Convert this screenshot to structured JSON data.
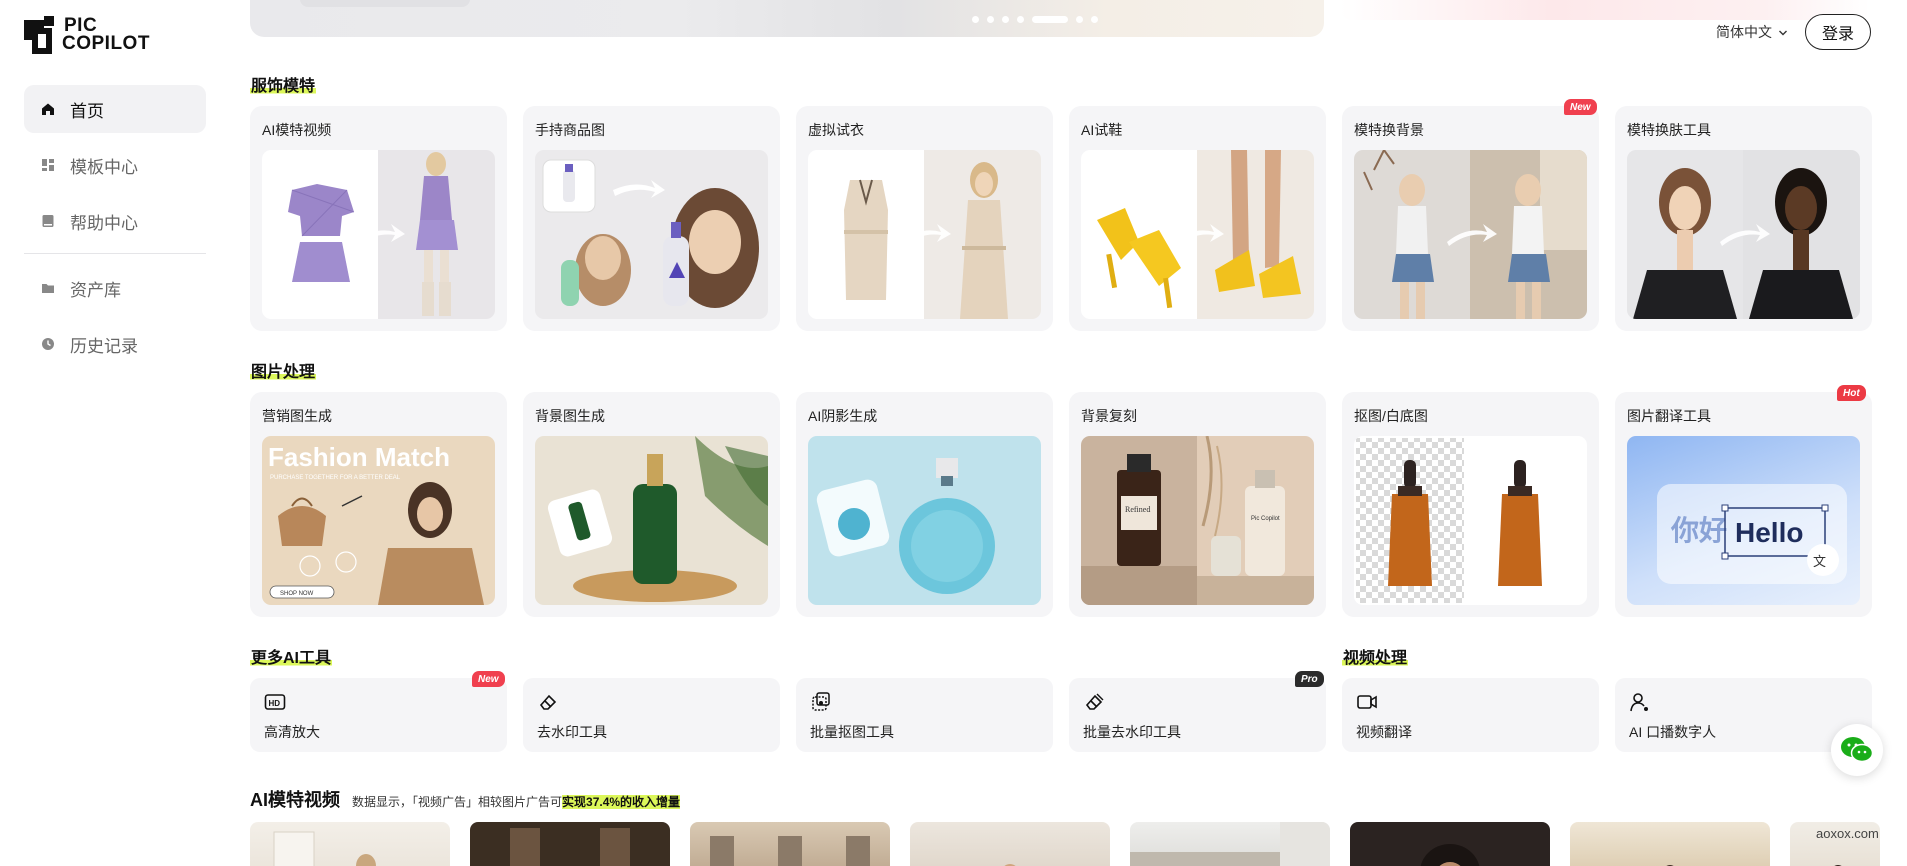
{
  "app": {
    "logo_line1": "PIC",
    "logo_line2": "COPILOT"
  },
  "sidebar": {
    "items": [
      {
        "label": "首页",
        "icon": "home-icon",
        "active": true
      },
      {
        "label": "模板中心",
        "icon": "template-icon",
        "active": false
      },
      {
        "label": "帮助中心",
        "icon": "book-icon",
        "active": false
      },
      {
        "label": "资产库",
        "icon": "folder-icon",
        "active": false
      },
      {
        "label": "历史记录",
        "icon": "history-icon",
        "active": false
      }
    ]
  },
  "header": {
    "language": "简体中文",
    "login_label": "登录"
  },
  "sections": {
    "apparel": {
      "title": "服饰模特",
      "cards": [
        {
          "label": "AI模特视频"
        },
        {
          "label": "手持商品图"
        },
        {
          "label": "虚拟试衣"
        },
        {
          "label": "AI试鞋"
        },
        {
          "label": "模特换背景",
          "badge": "New"
        },
        {
          "label": "模特换肤工具"
        }
      ]
    },
    "image": {
      "title": "图片处理",
      "cards": [
        {
          "label": "营销图生成",
          "art_title": "Fashion Match",
          "art_sub": "PURCHASE TOGETHER FOR A BETTER DEAL",
          "art_btn": "SHOP NOW"
        },
        {
          "label": "背景图生成"
        },
        {
          "label": "AI阴影生成"
        },
        {
          "label": "背景复刻",
          "bottle_left": "Refined",
          "bottle_right": "Pic Copilot"
        },
        {
          "label": "抠图/白底图"
        },
        {
          "label": "图片翻译工具",
          "badge": "Hot",
          "art_src": "你好",
          "art_dst": "Hello"
        }
      ]
    },
    "more_tools": {
      "title": "更多AI工具",
      "tools": [
        {
          "label": "高清放大",
          "icon": "hd-icon",
          "badge": "New"
        },
        {
          "label": "去水印工具",
          "icon": "eraser-icon"
        },
        {
          "label": "批量抠图工具",
          "icon": "batch-cutout-icon"
        },
        {
          "label": "批量去水印工具",
          "icon": "batch-eraser-icon",
          "badge": "Pro"
        }
      ]
    },
    "video": {
      "title": "视频处理",
      "tools": [
        {
          "label": "视频翻译",
          "icon": "video-icon"
        },
        {
          "label": "AI 口播数字人",
          "icon": "digital-human-icon"
        }
      ]
    },
    "model_video": {
      "title": "AI模特视频",
      "desc_prefix": "数据显示，「视频广告」相较图片广告可",
      "desc_highlight": "实现37.4%的收入增量"
    }
  },
  "watermark": "aoxox.com",
  "colors": {
    "highlight": "#dcf75a",
    "badge_red": "#f0404f",
    "wechat_green": "#1aad19"
  }
}
